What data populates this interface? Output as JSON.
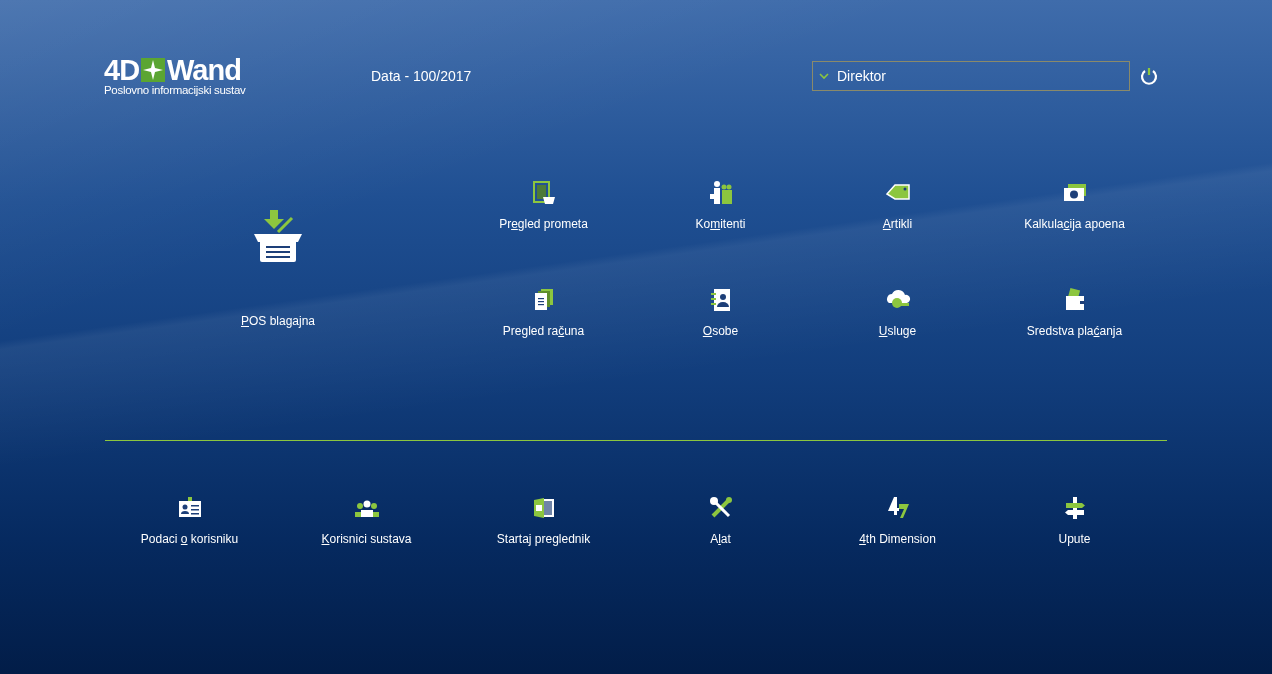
{
  "header": {
    "logo": {
      "left": "4D",
      "right": "Wand",
      "tagline": "Poslovno informacijski sustav"
    },
    "database": "Data - 100/2017",
    "user_select": {
      "value": "Direktor"
    }
  },
  "featured": {
    "label": {
      "underlined": "P",
      "after": "OS blagajna"
    }
  },
  "modules": [
    {
      "label": {
        "before": "Pr",
        "underlined": "e",
        "after": "gled prometa"
      }
    },
    {
      "label": {
        "before": "Ko",
        "underlined": "m",
        "after": "itenti"
      }
    },
    {
      "label": {
        "underlined": "A",
        "after": "rtikli"
      }
    },
    {
      "label": {
        "before": "Kalkula",
        "underlined": "c",
        "after": "ija apoena"
      }
    },
    {
      "label": {
        "before": "Pregled ra",
        "underlined": "č",
        "after": "una"
      }
    },
    {
      "label": {
        "underlined": "O",
        "after": "sobe"
      }
    },
    {
      "label": {
        "underlined": "U",
        "after": "sluge"
      }
    },
    {
      "label": {
        "before": "Sredstva pla",
        "underlined": "ć",
        "after": "anja"
      }
    }
  ],
  "tools": [
    {
      "label": {
        "before": "Podaci ",
        "underlined": "o",
        "after": " korisniku"
      }
    },
    {
      "label": {
        "underlined": "K",
        "after": "orisnici sustava"
      }
    },
    {
      "label": {
        "before": "Startaj preglednik"
      }
    },
    {
      "label": {
        "before": "A",
        "underlined": "l",
        "after": "at"
      }
    },
    {
      "label": {
        "underlined": "4",
        "after": "th Dimension"
      }
    },
    {
      "label": {
        "before": "Upute"
      }
    }
  ]
}
